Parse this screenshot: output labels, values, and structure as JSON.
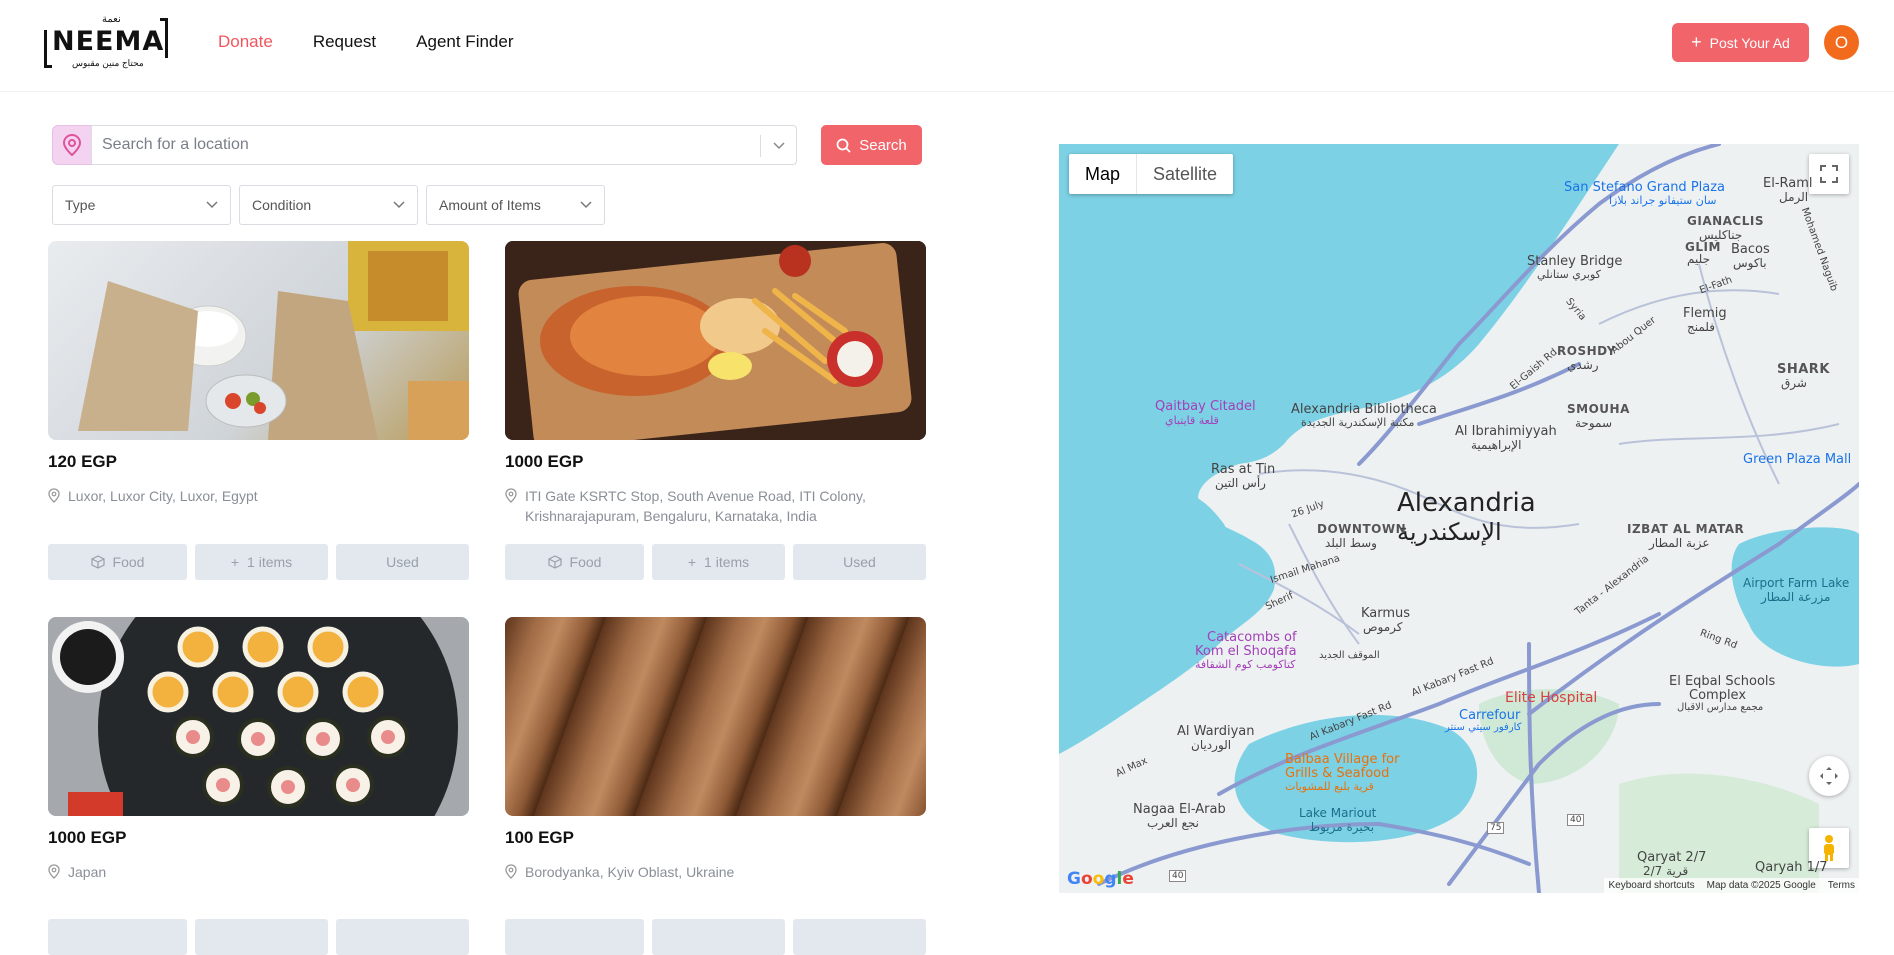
{
  "header": {
    "logo_text": "NEEMA",
    "logo_ar_top": "نعمة",
    "logo_ar_bottom": "محتاج منين مقبوس",
    "nav": [
      {
        "label": "Donate",
        "active": true
      },
      {
        "label": "Request",
        "active": false
      },
      {
        "label": "Agent Finder",
        "active": false
      }
    ],
    "post_button": "Post Your Ad",
    "avatar_initial": "O"
  },
  "search": {
    "placeholder": "Search for a location",
    "button": "Search"
  },
  "filters": [
    {
      "label": "Type"
    },
    {
      "label": "Condition"
    },
    {
      "label": "Amount of Items"
    }
  ],
  "listings": [
    {
      "price": "120 EGP",
      "location": "Luxor, Luxor City, Luxor, Egypt",
      "tags": [
        "Food",
        "1 items",
        "Used"
      ],
      "image": "shawarma-wraps"
    },
    {
      "price": "1000 EGP",
      "location": "ITI Gate KSRTC Stop, South Avenue Road, ITI Colony, Krishnarajapuram, Bengaluru, Karnataka, India",
      "tags": [
        "Food",
        "1 items",
        "Used"
      ],
      "image": "shawarma-plate"
    },
    {
      "price": "1000 EGP",
      "location": "Japan",
      "tags": [],
      "image": "sushi-platter"
    },
    {
      "price": "100 EGP",
      "location": "Borodyanka, Kyiv Oblast, Ukraine",
      "tags": [],
      "image": "brown-leather"
    }
  ],
  "map": {
    "toggle": [
      "Map",
      "Satellite"
    ],
    "city": "Alexandria",
    "city_ar": "الإسكندرية",
    "labels": {
      "san_stefano": "San Stefano Grand Plaza",
      "san_stefano_ar": "سان ستيفانو جراند بلازا",
      "el_raml": "El-Raml",
      "el_raml_ar": "الرمل",
      "gianaclis": "GIANACLIS",
      "gianaclis_ar": "جناكليس",
      "glim": "GLIM",
      "glim_ar": "جليم",
      "bacos": "Bacos",
      "bacos_ar": "باكوس",
      "stanley": "Stanley Bridge",
      "stanley_ar": "كوبري ستانلي",
      "flemig": "Flemig",
      "flemig_ar": "فلمنج",
      "roshdy": "ROSHDY",
      "roshdy_ar": "رشدي",
      "shark": "SHARK",
      "shark_ar": "شرق",
      "smouha": "SMOUHA",
      "smouha_ar": "سموحة",
      "qaitbay": "Qaitbay Citadel",
      "qaitbay_ar": "قلعة قايتباي",
      "bibliotheca": "Alexandria Bibliotheca",
      "bibliotheca_ar": "مكتبة الإسكندرية الجديدة",
      "ibrahimiyyah": "Al Ibrahimiyyah",
      "ibrahimiyyah_ar": "الإبراهيمية",
      "green_plaza": "Green Plaza Mall",
      "ras_at_tin": "Ras at Tin",
      "ras_at_tin_ar": "رأس التين",
      "downtown": "DOWNTOWN",
      "downtown_ar": "وسط البلد",
      "izbat": "IZBAT AL MATAR",
      "izbat_ar": "عزبة المطار",
      "airport_lake": "Airport Farm Lake",
      "airport_lake_ar": "مزرعة المطار",
      "karmus": "Karmus",
      "karmus_ar": "كرموص",
      "catacombs": "Catacombs of",
      "catacombs2": "Kom el Shoqafa",
      "catacombs_ar": "كتاكومب كوم الشقافة",
      "eqbal": "El Eqbal Schools",
      "eqbal2": "Complex",
      "eqbal_ar": "مجمع مدارس الاقبال",
      "elite": "Elite Hospital",
      "carrefour": "Carrefour",
      "carrefour_ar": "كارفور سيتي سنتر",
      "wardiyan": "Al Wardiyan",
      "wardiyan_ar": "الورديان",
      "balbaa": "Balbaa Village for",
      "balbaa2": "Grills & Seafood",
      "balbaa_ar": "قرية بلبع للمشويات",
      "mariout": "Lake Mariout",
      "mariout_ar": "بحيرة مريوط",
      "nagaa": "Nagaa El-Arab",
      "nagaa_ar": "نجع العرب",
      "qaryat": "Qaryat 2/7",
      "qaryat_ar": "قرية 2/7",
      "qaryah17": "Qaryah 1/7",
      "road_26july": "26 July",
      "road_ismail": "Ismail Mahana",
      "road_sherif": "Sherif",
      "road_kabary": "Al Kabary Fast Rd",
      "road_kabary2": "Al Kabary Fast Rd",
      "road_tanta": "Tanta - Alexandria",
      "road_ring": "Ring Rd",
      "road_gaish": "El-Gaish Rd",
      "road_abouqir": "Abou Quer",
      "road_syria": "Syria",
      "road_elfath": "El-Fath",
      "road_naguib": "Mohamed Naguib",
      "road_almax": "Al Max",
      "road_40": "40",
      "road_75": "75",
      "road_40b": "40",
      "mawqaf": "الموقف الجديد"
    },
    "google": "Google",
    "footer": [
      "Keyboard shortcuts",
      "Map data ©2025 Google",
      "Terms"
    ]
  }
}
